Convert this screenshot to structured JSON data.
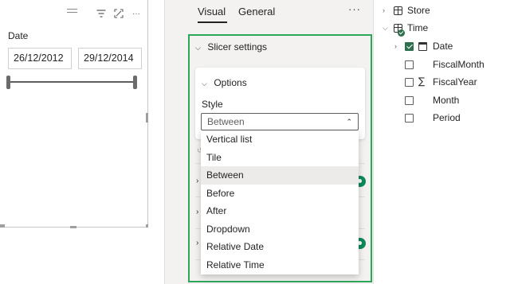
{
  "slicer": {
    "icons": [
      "drag-grip-icon",
      "filter-icon",
      "focus-mode-icon",
      "more-options-icon"
    ],
    "more_glyph": "···",
    "title": "Date",
    "start_date": "26/12/2012",
    "end_date": "29/12/2014",
    "range_handles": [
      "start",
      "end"
    ]
  },
  "format_pane": {
    "tabs": [
      {
        "label": "Visual",
        "active": true
      },
      {
        "label": "General",
        "active": false
      }
    ],
    "more_glyph": "···",
    "section_title": "Slicer settings",
    "options_title": "Options",
    "style_label": "Style",
    "style_value": "Between",
    "highlight_color": "#2ea65a"
  },
  "dropdown": {
    "items": [
      "Vertical list",
      "Tile",
      "Between",
      "Before",
      "After",
      "Dropdown",
      "Relative Date",
      "Relative Time"
    ],
    "selected": "Between"
  },
  "fields": {
    "tables": [
      {
        "name": "Store",
        "expanded": false
      },
      {
        "name": "Time",
        "expanded": true
      }
    ],
    "time_fields": [
      {
        "name": "Date",
        "checked": true,
        "icon": "calendar-icon",
        "expandable": true
      },
      {
        "name": "FiscalMonth",
        "checked": false,
        "icon": "",
        "expandable": false
      },
      {
        "name": "FiscalYear",
        "checked": false,
        "icon": "sigma-icon",
        "expandable": false
      },
      {
        "name": "Month",
        "checked": false,
        "icon": "",
        "expandable": false
      },
      {
        "name": "Period",
        "checked": false,
        "icon": "",
        "expandable": false
      }
    ],
    "sigma_glyph": "∑"
  },
  "colors": {
    "accent": "#2ea65a",
    "checkbox_checked": "#2f6f4e",
    "toggle_on": "#0e8a5a"
  }
}
